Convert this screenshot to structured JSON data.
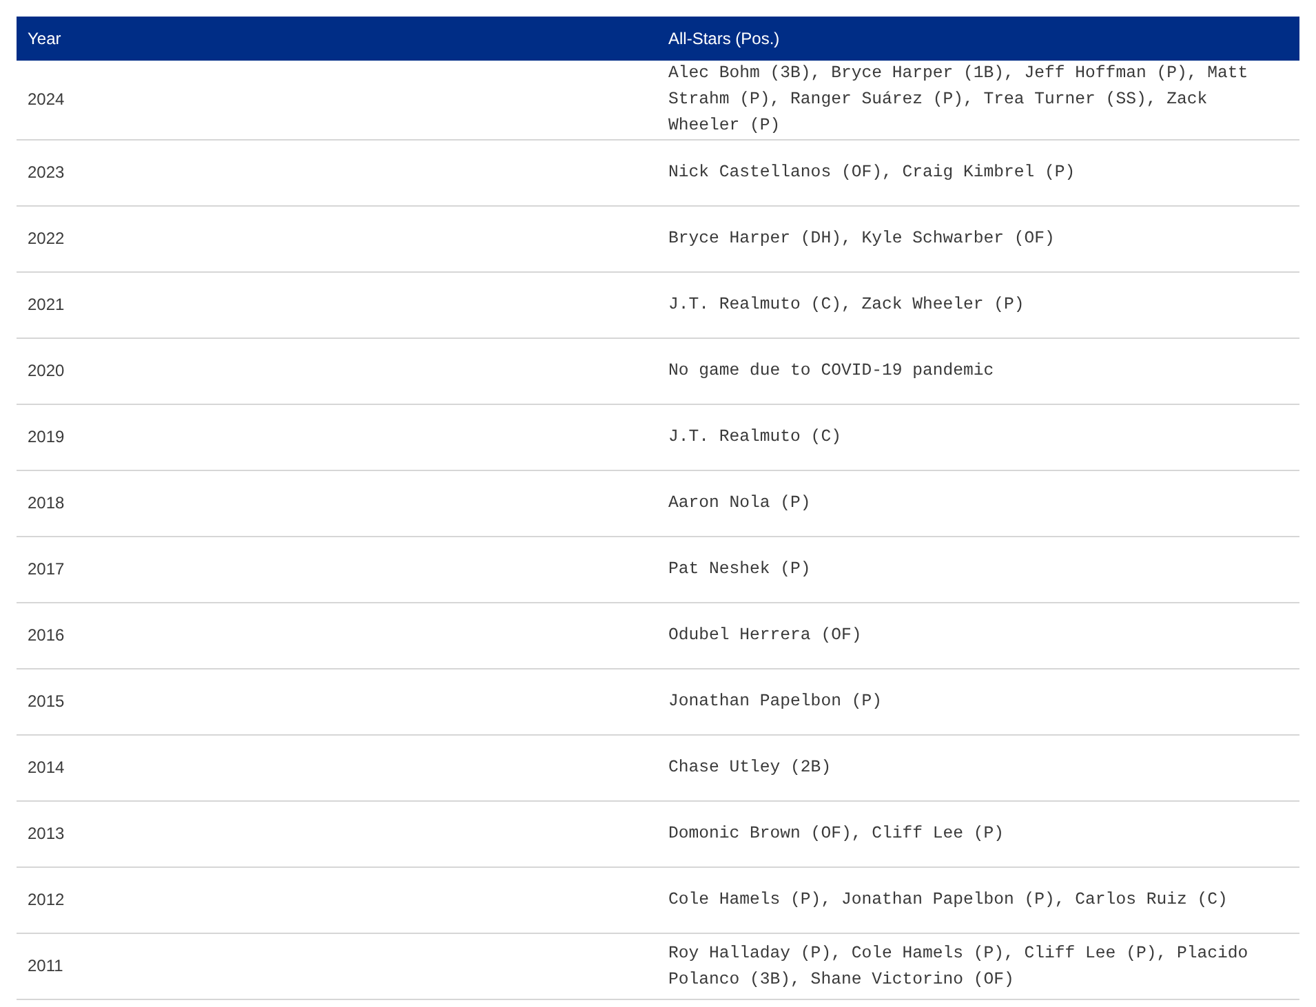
{
  "table": {
    "columns": [
      "Year",
      "All-Stars (Pos.)"
    ],
    "rows": [
      {
        "year": "2024",
        "all_stars": "Alec Bohm (3B), Bryce Harper (1B), Jeff Hoffman (P), Matt Strahm (P), Ranger Suárez (P), Trea Turner (SS), Zack Wheeler (P)"
      },
      {
        "year": "2023",
        "all_stars": "Nick Castellanos (OF), Craig Kimbrel (P)"
      },
      {
        "year": "2022",
        "all_stars": "Bryce Harper (DH), Kyle Schwarber (OF)"
      },
      {
        "year": "2021",
        "all_stars": "J.T. Realmuto (C), Zack Wheeler (P)"
      },
      {
        "year": "2020",
        "all_stars": "No game due to COVID-19 pandemic"
      },
      {
        "year": "2019",
        "all_stars": "J.T. Realmuto (C)"
      },
      {
        "year": "2018",
        "all_stars": "Aaron Nola (P)"
      },
      {
        "year": "2017",
        "all_stars": "Pat Neshek (P)"
      },
      {
        "year": "2016",
        "all_stars": "Odubel Herrera (OF)"
      },
      {
        "year": "2015",
        "all_stars": "Jonathan Papelbon (P)"
      },
      {
        "year": "2014",
        "all_stars": "Chase Utley (2B)"
      },
      {
        "year": "2013",
        "all_stars": "Domonic Brown (OF), Cliff Lee (P)"
      },
      {
        "year": "2012",
        "all_stars": "Cole Hamels (P), Jonathan Papelbon (P), Carlos Ruiz (C)"
      },
      {
        "year": "2011",
        "all_stars": "Roy Halladay (P), Cole Hamels (P), Cliff Lee (P), Placido Polanco (3B), Shane Victorino (OF)"
      }
    ]
  }
}
